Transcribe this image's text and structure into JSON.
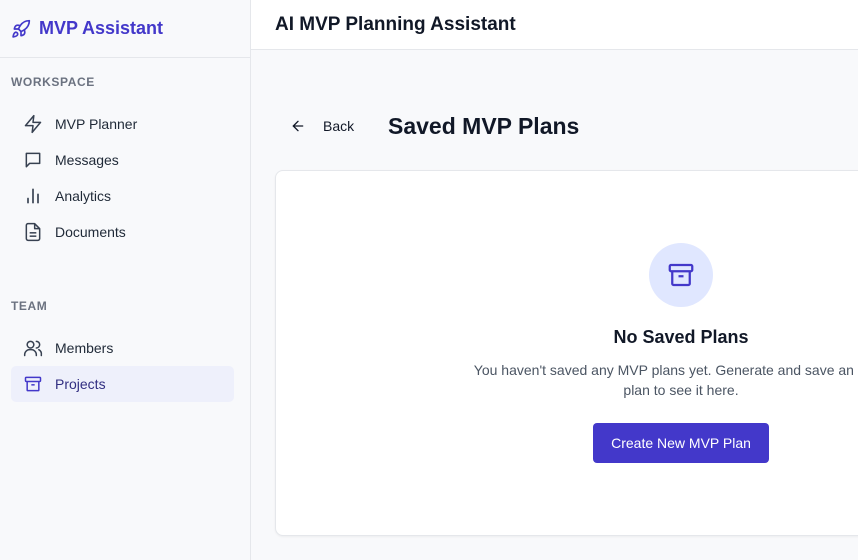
{
  "brand": {
    "name": "MVP Assistant",
    "icon": "rocket-icon"
  },
  "sidebar": {
    "sections": [
      {
        "title": "WORKSPACE",
        "items": [
          {
            "label": "MVP Planner",
            "icon": "lightning-icon"
          },
          {
            "label": "Messages",
            "icon": "message-icon"
          },
          {
            "label": "Analytics",
            "icon": "bar-chart-icon"
          },
          {
            "label": "Documents",
            "icon": "document-icon"
          }
        ]
      },
      {
        "title": "TEAM",
        "items": [
          {
            "label": "Members",
            "icon": "users-icon"
          },
          {
            "label": "Projects",
            "icon": "archive-icon",
            "active": true
          }
        ]
      }
    ]
  },
  "header": {
    "title": "AI MVP Planning Assistant"
  },
  "page": {
    "back_label": "Back",
    "title": "Saved MVP Plans"
  },
  "empty_state": {
    "icon": "archive-icon",
    "title": "No Saved Plans",
    "description": "You haven't saved any MVP plans yet. Generate and save an MVP plan to see it here.",
    "button_label": "Create New MVP Plan"
  },
  "colors": {
    "accent": "#4338ca",
    "accent_soft": "#e0e7ff",
    "active_bg": "#eef0fb"
  }
}
